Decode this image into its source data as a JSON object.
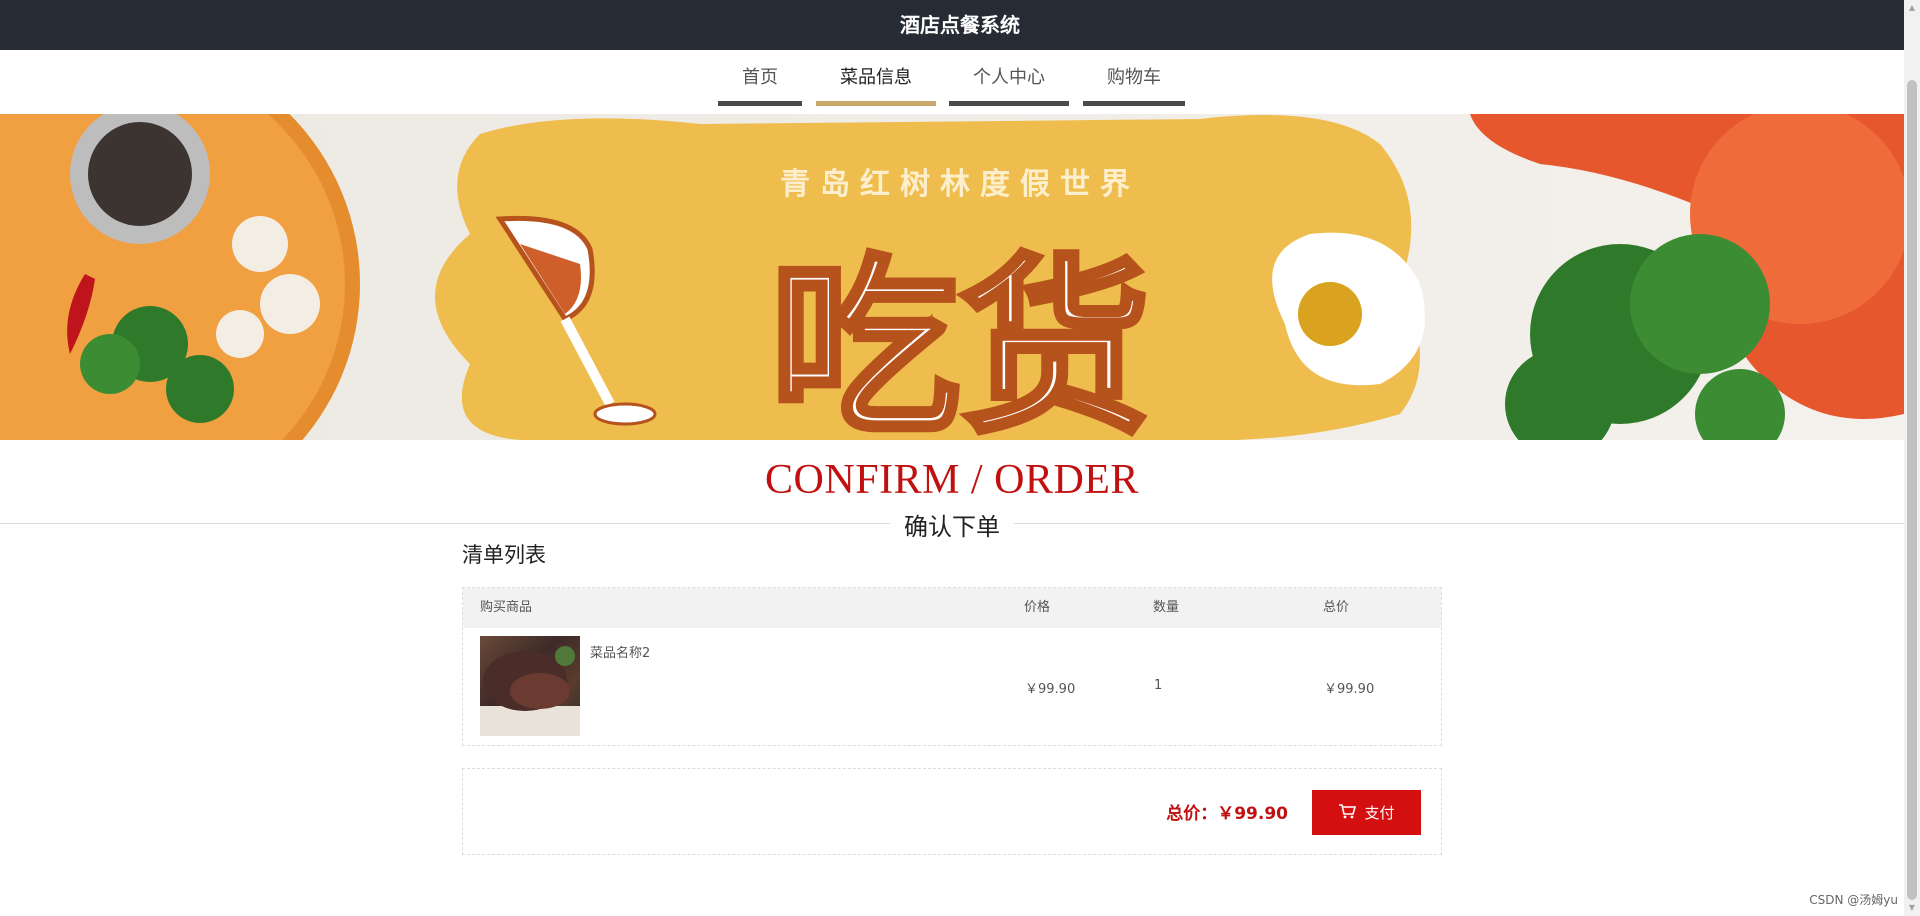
{
  "header": {
    "title": "酒店点餐系统"
  },
  "nav": {
    "items": [
      {
        "label": "首页",
        "active": false
      },
      {
        "label": "菜品信息",
        "active": true
      },
      {
        "label": "个人中心",
        "active": false
      },
      {
        "label": "购物车",
        "active": false
      }
    ]
  },
  "banner": {
    "subtitle": "青岛红树林度假世界",
    "headline": "吃货"
  },
  "section": {
    "title": "CONFIRM / ORDER",
    "subtitle": "确认下单"
  },
  "cart": {
    "list_title": "清单列表",
    "columns": {
      "product": "购买商品",
      "price": "价格",
      "qty": "数量",
      "total": "总价"
    },
    "rows": [
      {
        "name": "菜品名称2",
        "price": "￥99.90",
        "qty": "1",
        "total": "￥99.90"
      }
    ]
  },
  "summary": {
    "total_label": "总价：",
    "total_value": "￥99.90",
    "pay_label": "支付"
  },
  "watermark": "CSDN @汤姆yu",
  "colors": {
    "topbar": "#272b33",
    "accent_red": "#d40f0f",
    "active_nav": "#c9a96b"
  }
}
